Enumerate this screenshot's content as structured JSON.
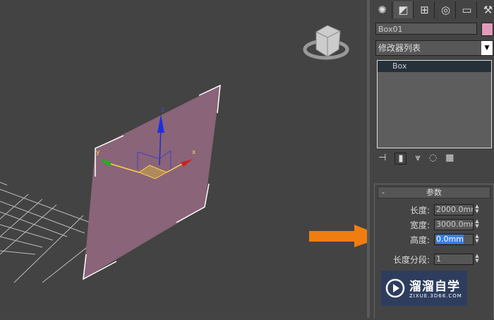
{
  "viewport": {
    "axis_x": "x",
    "axis_y": "y",
    "axis_z": "z"
  },
  "panel": {
    "tabs": [
      "create-icon",
      "modify-icon",
      "hierarchy-icon",
      "motion-icon",
      "display-icon",
      "utilities-icon"
    ],
    "object_name": "Box01",
    "object_color": "#e09bb8",
    "modifier_list": "修改器列表",
    "stack_items": [
      "Box"
    ],
    "params": {
      "title": "参数",
      "collapse": "-",
      "fields": [
        {
          "label": "长度:",
          "value": "2000.0mm"
        },
        {
          "label": "宽度:",
          "value": "3000.0mm"
        },
        {
          "label": "高度:",
          "value": "0.0mm"
        },
        {
          "label": "长度分段:",
          "value": "1"
        }
      ]
    }
  },
  "watermark": {
    "title": "溜溜自学",
    "url": "ZIXUE.3D66.COM"
  }
}
